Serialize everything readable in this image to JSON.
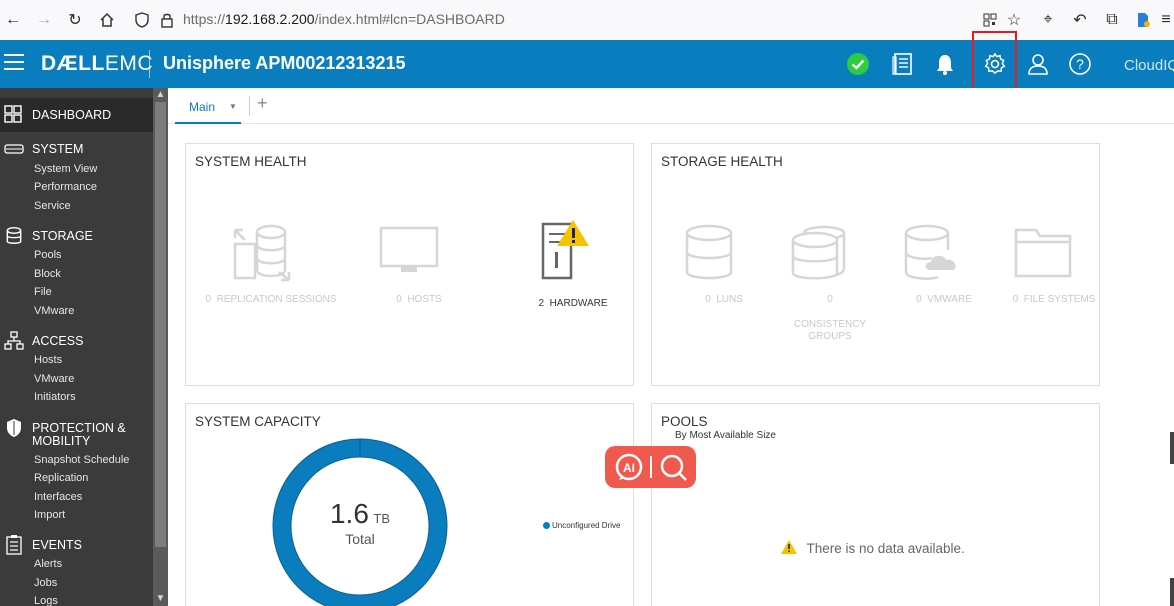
{
  "browser": {
    "url_prefix": "https://",
    "url_host": "192.168.2.200",
    "url_path": "/index.html#lcn=DASHBOARD"
  },
  "header": {
    "logo_dell": "DÆLL",
    "logo_emc": "EMC",
    "title": "Unisphere APM00212313215",
    "cloudiq": "CloudIQ",
    "icons": [
      "status-ok-icon",
      "report-icon",
      "bell-icon",
      "gear-icon",
      "user-icon",
      "help-icon"
    ]
  },
  "sidebar": {
    "dashboard": "DASHBOARD",
    "sections": [
      {
        "title": "SYSTEM",
        "items": [
          "System View",
          "Performance",
          "Service"
        ]
      },
      {
        "title": "STORAGE",
        "items": [
          "Pools",
          "Block",
          "File",
          "VMware"
        ]
      },
      {
        "title": "ACCESS",
        "items": [
          "Hosts",
          "VMware",
          "Initiators"
        ]
      },
      {
        "title_line1": "PROTECTION &",
        "title_line2": "MOBILITY",
        "items": [
          "Snapshot Schedule",
          "Replication",
          "Interfaces",
          "Import"
        ]
      },
      {
        "title": "EVENTS",
        "items": [
          "Alerts",
          "Jobs",
          "Logs"
        ]
      }
    ]
  },
  "tabs": {
    "main": "Main",
    "add": "+"
  },
  "system_health": {
    "title": "SYSTEM HEALTH",
    "metrics": [
      {
        "count": "0",
        "label": "REPLICATION SESSIONS"
      },
      {
        "count": "0",
        "label": "HOSTS"
      },
      {
        "count": "2",
        "label": "HARDWARE"
      }
    ]
  },
  "storage_health": {
    "title": "STORAGE HEALTH",
    "metrics": [
      {
        "count": "0",
        "label": "LUNS"
      },
      {
        "count": "0",
        "label_line1": "CONSISTENCY",
        "label_line2": "GROUPS"
      },
      {
        "count": "0",
        "label": "VMWARE"
      },
      {
        "count": "0",
        "label": "FILE SYSTEMS"
      }
    ]
  },
  "system_capacity": {
    "title": "SYSTEM CAPACITY",
    "value": "1.6",
    "unit": "TB",
    "caption": "Total",
    "legend": "Unconfigured Drive"
  },
  "pools": {
    "title": "POOLS",
    "subtitle": "By Most Available Size",
    "empty_message": "There is no data available."
  },
  "colors": {
    "header_bg": "#0a7dbf",
    "sidebar_bg": "#3b3b3b",
    "accent": "#0a7dbf",
    "ok": "#2ecc40",
    "warn": "#f5c400",
    "ai_button": "#f05a4e"
  }
}
